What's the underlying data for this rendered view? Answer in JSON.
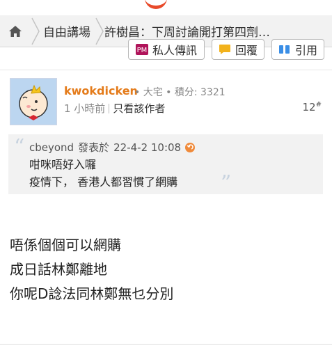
{
  "breadcrumb": {
    "home_icon": "home-icon",
    "forum": "自由講場",
    "thread_title": "許樹昌：下周討論開打第四劑…"
  },
  "actions": {
    "pm": "私人傳訊",
    "reply": "回覆",
    "quote": "引用"
  },
  "post": {
    "username": "kwokdicken",
    "meta": "• 大宅 • 積分: 3321",
    "time": "1 小時前",
    "author_only": "只看該作者",
    "floor": "12",
    "floor_mark": "#"
  },
  "quote": {
    "author": "cbeyond",
    "posted_label": "發表於",
    "datetime": "22-4-2 10:08",
    "lines": [
      "咁咪唔好入囉",
      "疫情下， 香港人都習慣了網購"
    ]
  },
  "body_lines": [
    "唔係個個可以網購",
    "成日話林鄭離地",
    "你呢D諗法同林鄭無乜分別"
  ],
  "colors": {
    "accent": "#e84a2a",
    "username": "#e47b1a",
    "pm_icon": "#b0145a",
    "reply_icon": "#f2b21c",
    "quote_icon": "#3a8ee6"
  }
}
